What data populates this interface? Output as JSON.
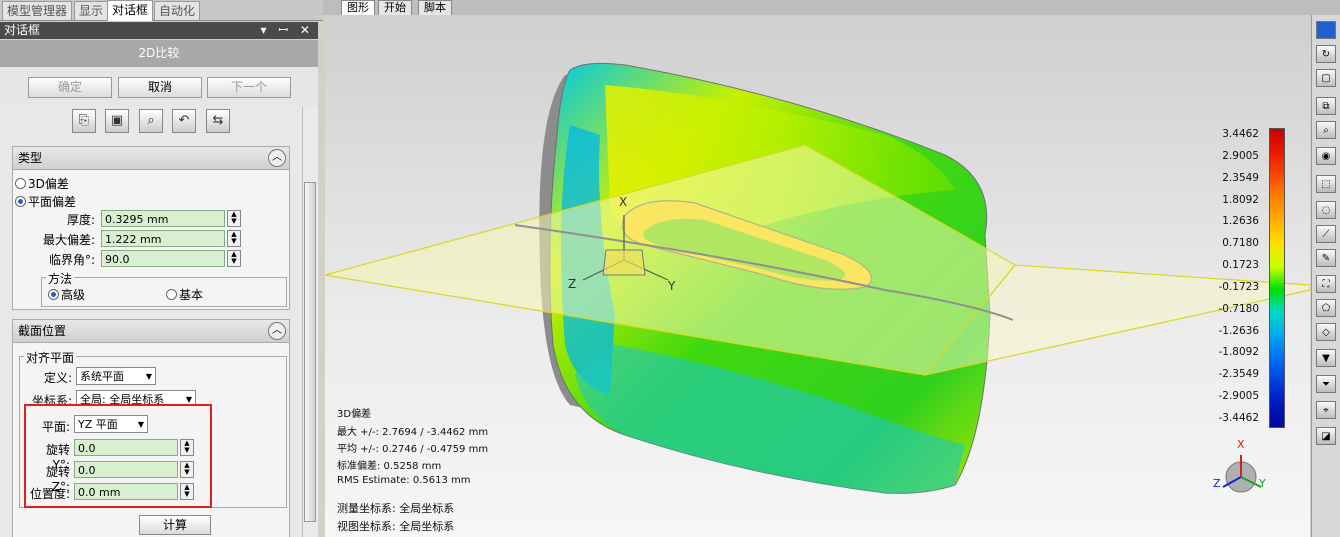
{
  "left_tabs": [
    "模型管理器",
    "显示",
    "对话框",
    "自动化"
  ],
  "panel": {
    "header": "对话框",
    "header_icons": "▾ ꟷ ✕",
    "subtitle": "2D比较",
    "buttons": {
      "ok": "确定",
      "cancel": "取消",
      "next": "下一个"
    }
  },
  "type_section": {
    "title": "类型",
    "options": [
      "3D偏差",
      "平面偏差"
    ],
    "selected": "平面偏差",
    "thickness_label": "厚度:",
    "thickness_value": "0.3295 mm",
    "max_dev_label": "最大偏差:",
    "max_dev_value": "1.222 mm",
    "critical_angle_label": "临界角°:",
    "critical_angle_value": "90.0",
    "method_group": "方法",
    "method_options": [
      "高级",
      "基本"
    ],
    "method_selected": "高级"
  },
  "section_pos": {
    "title": "截面位置",
    "align_group": "对齐平面",
    "define_label": "定义:",
    "define_value": "系统平面",
    "coord_label": "坐标系:",
    "coord_value": "全局: 全局坐标系",
    "plane_label": "平面:",
    "plane_value": "YZ 平面",
    "rot_y_label": "旋转 Y°:",
    "rot_y_value": "0.0",
    "rot_z_label": "旋转 Z°:",
    "rot_z_value": "0.0",
    "position_label": "位置度:",
    "position_value": "0.0 mm",
    "compute": "计算"
  },
  "view_tabs": [
    "图形",
    "开始",
    "脚本"
  ],
  "axes": {
    "x": "X",
    "y": "Y",
    "z": "Z"
  },
  "stats": {
    "title": "3D偏差",
    "max": "最大 +/-: 2.7694 / -3.4462 mm",
    "avg": "平均 +/-: 0.2746 / -0.4759 mm",
    "std": "标准偏差: 0.5258 mm",
    "rms": "RMS Estimate: 0.5613 mm",
    "measure_cs": "测量坐标系: 全局坐标系",
    "view_cs": "视图坐标系: 全局坐标系"
  },
  "legend": {
    "ticks": [
      "3.4462",
      "2.9005",
      "2.3549",
      "1.8092",
      "1.2636",
      "0.7180",
      "0.1723",
      "-0.1723",
      "-0.7180",
      "-1.2636",
      "-1.8092",
      "-2.3549",
      "-2.9005",
      "-3.4462"
    ],
    "colors": [
      "#c80000",
      "#e81800",
      "#f84800",
      "#ff8000",
      "#ffb000",
      "#ffe000",
      "#c8ff00",
      "#00e000",
      "#00d8c8",
      "#00a8f0",
      "#0070f0",
      "#0040e0",
      "#0018c0",
      "#000898"
    ]
  },
  "highlight_color": "#e02020"
}
